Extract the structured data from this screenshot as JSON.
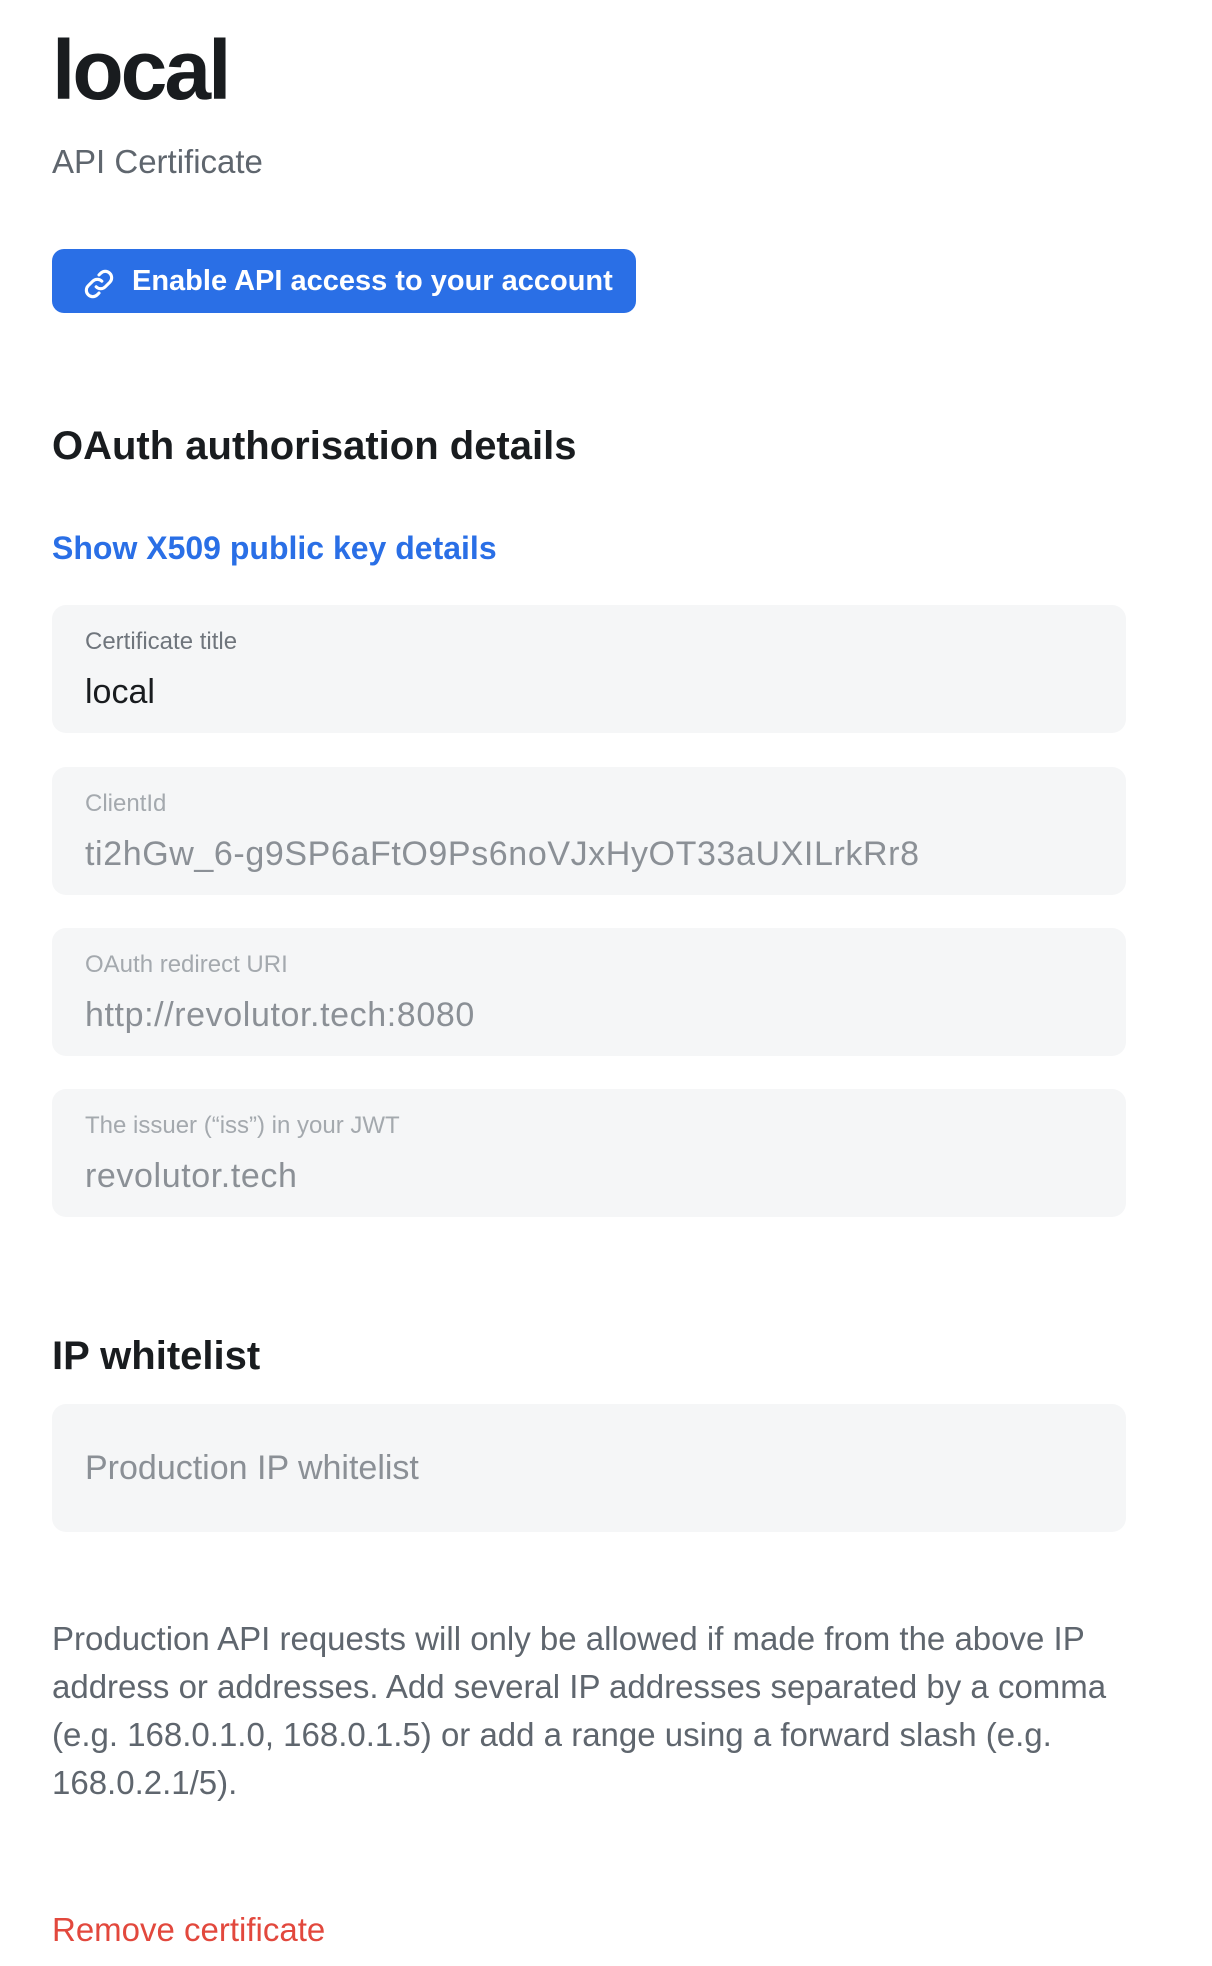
{
  "header": {
    "title": "local",
    "subtitle": "API Certificate"
  },
  "enable_button": {
    "icon": "link-icon",
    "label": "Enable API access to your account"
  },
  "oauth": {
    "heading": "OAuth authorisation details",
    "show_key_link": "Show X509 public key details",
    "fields": [
      {
        "label": "Certificate title",
        "value": "local",
        "editable": true
      },
      {
        "label": "ClientId",
        "value": "ti2hGw_6-g9SP6aFtO9Ps6noVJxHyOT33aUXILrkRr8",
        "editable": false
      },
      {
        "label": "OAuth redirect URI",
        "value": "http://revolutor.tech:8080",
        "editable": false
      },
      {
        "label": "The issuer (“iss”) in your JWT",
        "value": "revolutor.tech",
        "editable": false
      }
    ]
  },
  "ip_whitelist": {
    "heading": "IP whitelist",
    "placeholder": "Production IP whitelist",
    "value": "",
    "help_text": "Production API requests will only be allowed if made from the above IP address or addresses. Add several IP addresses separated by a comma (e.g. 168.0.1.0, 168.0.1.5) or add a range using a forward slash (e.g. 168.0.2.1/5)."
  },
  "remove_link": "Remove certificate",
  "colors": {
    "accent": "#2a6fe6",
    "danger": "#e2483d",
    "field_background": "#f5f6f7",
    "text_primary": "#191c1f",
    "text_secondary": "#5f666e"
  }
}
